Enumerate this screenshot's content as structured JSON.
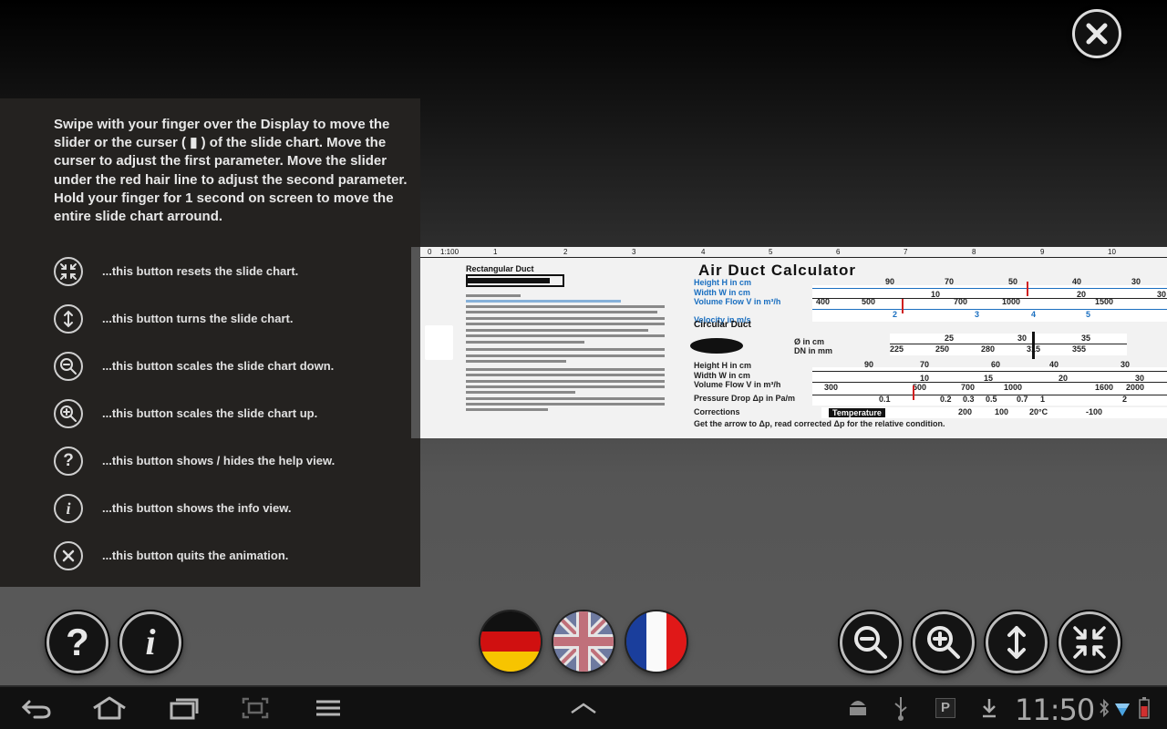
{
  "help": {
    "intro": "Swipe with your finger over the Display to move the slider or the curser ( ▮ ) of the slide chart. Move the curser to adjust the first parameter. Move the slider under the red hair line to adjust the second parameter. Hold your finger for 1 second on screen to move the entire slide chart arround.",
    "rows": [
      {
        "icon": "reset-icon",
        "text": "...this button resets the slide chart."
      },
      {
        "icon": "turn-icon",
        "text": "...this button turns the slide chart."
      },
      {
        "icon": "zoom-out-icon",
        "text": "...this button scales the slide chart down."
      },
      {
        "icon": "zoom-in-icon",
        "text": "...this button scales the slide chart up."
      },
      {
        "icon": "help-icon",
        "text": "...this button shows / hides the help view."
      },
      {
        "icon": "info-icon",
        "text": "...this button shows the info view."
      },
      {
        "icon": "quit-icon",
        "text": "...this button quits the animation."
      }
    ]
  },
  "chart": {
    "title": "Air Duct Calculator",
    "rect_title": "Rectangular Duct",
    "circ_title": "Circular Duct",
    "ruler": [
      "0",
      "1:100",
      "1",
      "2",
      "3",
      "4",
      "5",
      "6",
      "7",
      "8",
      "9",
      "10"
    ],
    "labels": {
      "height": "Height H in cm",
      "width": "Width W in cm",
      "volume_flow": "Volume Flow V in m³/h",
      "velocity": "Velocity in m/s",
      "diameter": "Ø in cm",
      "dn": "DN in mm",
      "pressure_drop": "Pressure Drop Δp in Pa/m",
      "corrections": "Corrections",
      "temperature": "Temperature",
      "footer": "Get the arrow to Δp, read corrected Δp for the relative condition."
    },
    "scale_values": {
      "height_top": [
        "90",
        "70",
        "50",
        "40",
        "30"
      ],
      "width_top": [
        "10",
        "20",
        "30"
      ],
      "flow_top": [
        "400",
        "500",
        "700",
        "1000",
        "1500"
      ],
      "velocity": [
        "2",
        "3",
        "4",
        "5"
      ],
      "dn": [
        "225",
        "250",
        "280",
        "315",
        "355"
      ],
      "diam": [
        "25",
        "30",
        "35"
      ],
      "height_mid": [
        "90",
        "70",
        "60",
        "40",
        "30"
      ],
      "width_mid": [
        "10",
        "15",
        "20",
        "30"
      ],
      "flow_mid": [
        "300",
        "500",
        "700",
        "1000",
        "1600",
        "2000"
      ],
      "pressure": [
        "0.1",
        "0.2",
        "0.3",
        "0.5",
        "0.7",
        "1",
        "2"
      ],
      "temp": [
        "200",
        "100",
        "20°C",
        "-100"
      ]
    }
  },
  "clock": "11:50",
  "colors": {
    "accent_blue": "#1a6fc0",
    "marker_red": "#d02020",
    "panel": "#242220"
  }
}
